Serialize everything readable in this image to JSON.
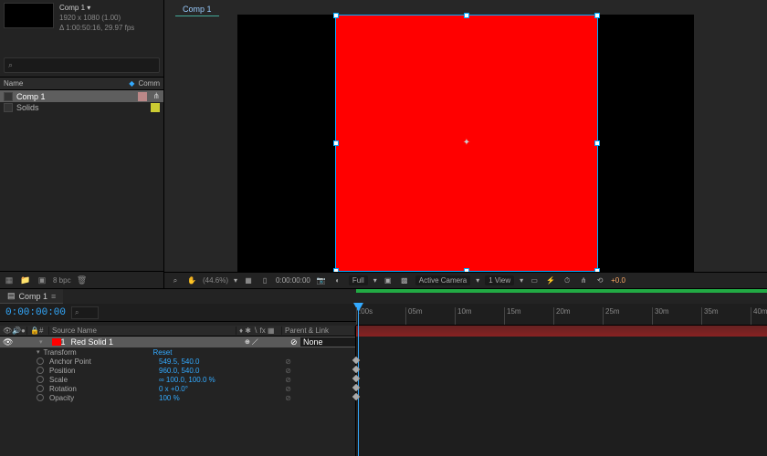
{
  "project": {
    "title": "Comp 1",
    "meta1": "1920 x 1080 (1.00)",
    "meta2": "Δ 1:00:50:16, 29.97 fps",
    "search_ph": "⌕",
    "cols": {
      "name": "Name",
      "type": "Comm"
    },
    "items": [
      {
        "name": "Comp 1",
        "sel": true,
        "color": "#b88"
      },
      {
        "name": "Solids",
        "sel": false,
        "color": "#cc3"
      }
    ],
    "bpc": "8 bpc"
  },
  "viewer": {
    "tab": "Comp 1",
    "zoom": "(44.6%)",
    "time": "0:00:00:00",
    "res": "Full",
    "camera": "Active Camera",
    "views": "1 View",
    "exp": "+0.0"
  },
  "timeline": {
    "tab": "Comp 1",
    "timecode": "0:00:00:00",
    "search_ph": "⌕",
    "cols": {
      "source": "Source Name",
      "parent": "Parent & Link"
    },
    "ruler": [
      ":00s",
      "05m",
      "10m",
      "15m",
      "20m",
      "25m",
      "30m",
      "35m",
      "40m"
    ],
    "layer": {
      "num": "1",
      "name": "Red Solid 1",
      "color": "#f00",
      "mode": "None",
      "parent": "⊘"
    },
    "transform": {
      "label": "Transform",
      "reset": "Reset",
      "props": [
        {
          "name": "Anchor Point",
          "val": "549.5, 540.0"
        },
        {
          "name": "Position",
          "val": "960.0, 540.0"
        },
        {
          "name": "Scale",
          "val": "∞ 100.0, 100.0 %"
        },
        {
          "name": "Rotation",
          "val": "0 x +0.0°"
        },
        {
          "name": "Opacity",
          "val": "100 %"
        }
      ]
    }
  }
}
